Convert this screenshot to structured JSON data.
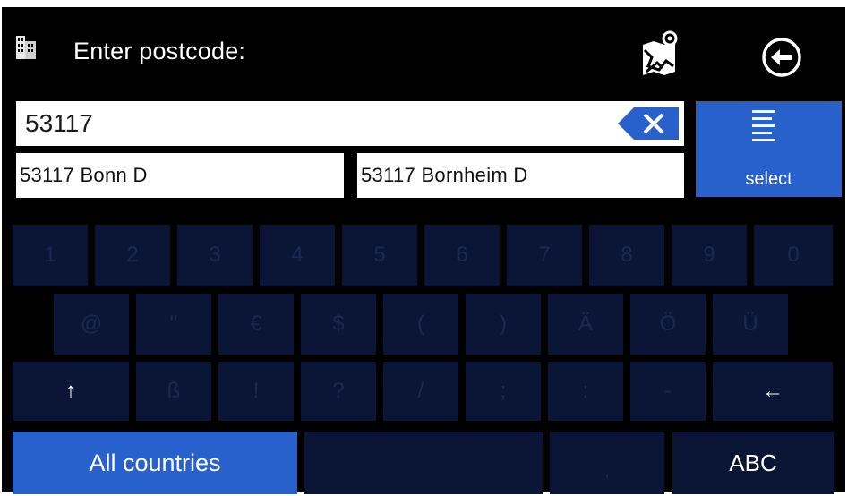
{
  "header": {
    "title": "Enter postcode:",
    "left_icon": "building-icon",
    "map_icon": "map-location-icon",
    "back_icon": "back-arrow-icon"
  },
  "input": {
    "value": "53117",
    "clear_icon": "clear-x-icon"
  },
  "suggestions": [
    {
      "label": "53117 Bonn  D"
    },
    {
      "label": "53117 Bornheim  D"
    }
  ],
  "select_button": {
    "label": "select",
    "icon": "list-icon"
  },
  "keyboard": {
    "row1": [
      "1",
      "2",
      "3",
      "4",
      "5",
      "6",
      "7",
      "8",
      "9",
      "0"
    ],
    "row2": [
      "@",
      "\"",
      "€",
      "$",
      "(",
      ")",
      "Ä",
      "Ö",
      "Ü"
    ],
    "row3": [
      "↑",
      "ß",
      "!",
      "?",
      "/",
      ";",
      ":",
      "-",
      "←"
    ],
    "bottom": {
      "countries_label": "All countries",
      "comma": ",",
      "abc_label": "ABC"
    }
  },
  "colors": {
    "background": "#000000",
    "accent": "#2860cc",
    "key_disabled": "#0b1536",
    "key_text_disabled": "#1b2a52",
    "text": "#ffffff"
  }
}
